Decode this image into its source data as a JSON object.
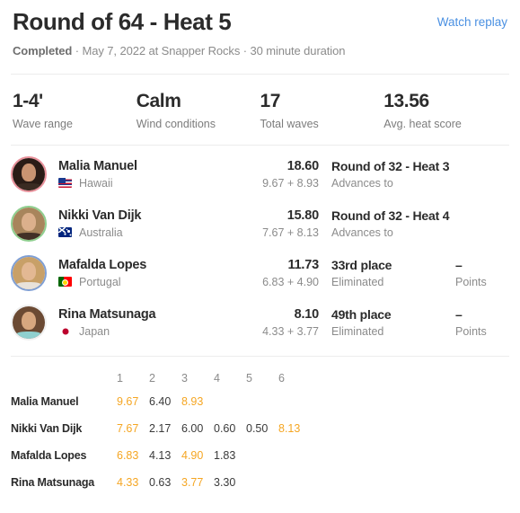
{
  "header": {
    "title": "Round of 64 - Heat 5",
    "watch_replay_label": "Watch replay",
    "status": "Completed",
    "meta": " · May 7, 2022 at Snapper Rocks · 30 minute duration"
  },
  "stats": [
    {
      "value": "1-4'",
      "label": "Wave range"
    },
    {
      "value": "Calm",
      "label": "Wind conditions"
    },
    {
      "value": "17",
      "label": "Total waves"
    },
    {
      "value": "13.56",
      "label": "Avg. heat score"
    }
  ],
  "athletes": [
    {
      "name": "Malia Manuel",
      "country": "Hawaii",
      "flag": "flag-hawaii",
      "ring": "ring-red",
      "total": "18.60",
      "breakdown": "9.67 + 8.93",
      "result": "Round of 32 - Heat 3",
      "result_sub": "Advances to",
      "points": "",
      "points_label": ""
    },
    {
      "name": "Nikki Van Dijk",
      "country": "Australia",
      "flag": "flag-australia",
      "ring": "ring-green",
      "total": "15.80",
      "breakdown": "7.67 + 8.13",
      "result": "Round of 32 - Heat 4",
      "result_sub": "Advances to",
      "points": "",
      "points_label": ""
    },
    {
      "name": "Mafalda Lopes",
      "country": "Portugal",
      "flag": "flag-portugal",
      "ring": "ring-blue",
      "total": "11.73",
      "breakdown": "6.83 + 4.90",
      "result": "33rd place",
      "result_sub": "Eliminated",
      "points": "–",
      "points_label": "Points"
    },
    {
      "name": "Rina Matsunaga",
      "country": "Japan",
      "flag": "flag-japan",
      "ring": "ring-white",
      "total": "8.10",
      "breakdown": "4.33 + 3.77",
      "result": "49th place",
      "result_sub": "Eliminated",
      "points": "–",
      "points_label": "Points"
    }
  ],
  "wave_table": {
    "columns": [
      "1",
      "2",
      "3",
      "4",
      "5",
      "6"
    ],
    "rows": [
      {
        "athlete": "Malia Manuel",
        "scores": [
          "9.67",
          "6.40",
          "8.93",
          "",
          "",
          ""
        ],
        "counted": [
          true,
          false,
          true,
          false,
          false,
          false
        ]
      },
      {
        "athlete": "Nikki Van Dijk",
        "scores": [
          "7.67",
          "2.17",
          "6.00",
          "0.60",
          "0.50",
          "8.13"
        ],
        "counted": [
          true,
          false,
          false,
          false,
          false,
          true
        ]
      },
      {
        "athlete": "Mafalda Lopes",
        "scores": [
          "6.83",
          "4.13",
          "4.90",
          "1.83",
          "",
          ""
        ],
        "counted": [
          true,
          false,
          true,
          false,
          false,
          false
        ]
      },
      {
        "athlete": "Rina Matsunaga",
        "scores": [
          "4.33",
          "0.63",
          "3.77",
          "3.30",
          "",
          ""
        ],
        "counted": [
          true,
          false,
          true,
          false,
          false,
          false
        ]
      }
    ]
  },
  "colors": {
    "accent_orange": "#f5a623",
    "link_blue": "#4a90e2",
    "text_dark": "#2b2b2b",
    "text_muted": "#8b8b8b"
  }
}
